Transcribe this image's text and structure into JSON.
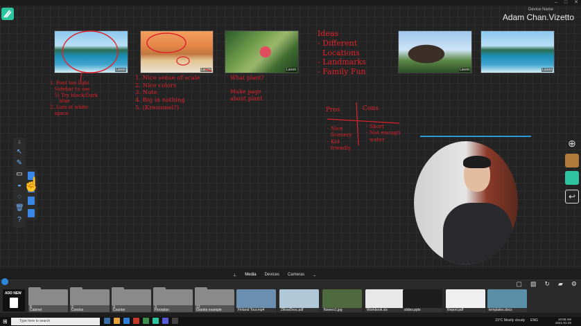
{
  "header": {
    "device_name_label": "Device Name",
    "user_name": "Adam Chan.Vizetto"
  },
  "window_controls": [
    "–",
    "□",
    "✕"
  ],
  "board": {
    "photos": [
      {
        "kind": "lagoon",
        "caption": "Lorem"
      },
      {
        "kind": "desert",
        "caption": "Lorem"
      },
      {
        "kind": "plant",
        "caption": "Lorem"
      },
      {
        "kind": "statue",
        "caption": "Lorem"
      },
      {
        "kind": "lagoon",
        "caption": "Lorem"
      }
    ],
    "notes": {
      "note1": "1. Font too light\n   Sidebar to see\n   5) Try black/Dark\n      blue\n2. Lots of white\n   space",
      "note2": "1. Nice sense of scale\n2. Nice colors\n3. Note\n4. Big in nothing\n5. (Kresumel?)",
      "note3": "What plant?\n\nMake page\nabout plant",
      "ideas": "Ideas\n- Different\n  Locations\n- Landmarks\n- Family Fun",
      "pros_title": "Pros",
      "cons_title": "Cons",
      "pros": "- Nice\n  Scenery\n- Kid\n  friendly",
      "cons": "- Short\n- Not enough\n  water"
    }
  },
  "media_tabs": [
    {
      "label": "Media",
      "active": true
    },
    {
      "label": "Devices",
      "active": false
    },
    {
      "label": "Cameras",
      "active": false
    }
  ],
  "tray": {
    "add_new_label": "ADD NEW",
    "folders": [
      {
        "count": "8",
        "name": "Cabinet"
      },
      {
        "count": "2",
        "name": "Condos"
      },
      {
        "count": "3",
        "name": "Counter"
      },
      {
        "count": "3",
        "name": "Floorplan"
      },
      {
        "count": "12",
        "name": "Granite example"
      }
    ],
    "files": [
      {
        "name": "Finland Tour.mp4",
        "color": "#6a8fb0"
      },
      {
        "name": "ZillowDesc.pdf",
        "color": "#b0c8d8"
      },
      {
        "name": "flowers1.jpg",
        "color": "#4e6a3e"
      },
      {
        "name": "Workbook.xls",
        "color": "#e8e8e8"
      },
      {
        "name": "slides.pptx",
        "color": "#1d1d1d"
      },
      {
        "name": "Report.pdf",
        "color": "#f0f0f0"
      },
      {
        "name": "templates.docx",
        "color": "#5b8fa8"
      }
    ]
  },
  "taskbar": {
    "search_placeholder": "Type here to search",
    "weather": "23°C  Mostly cloudy",
    "lang": "ENG",
    "time": "10:58 AM",
    "date": "2021-01-20"
  }
}
